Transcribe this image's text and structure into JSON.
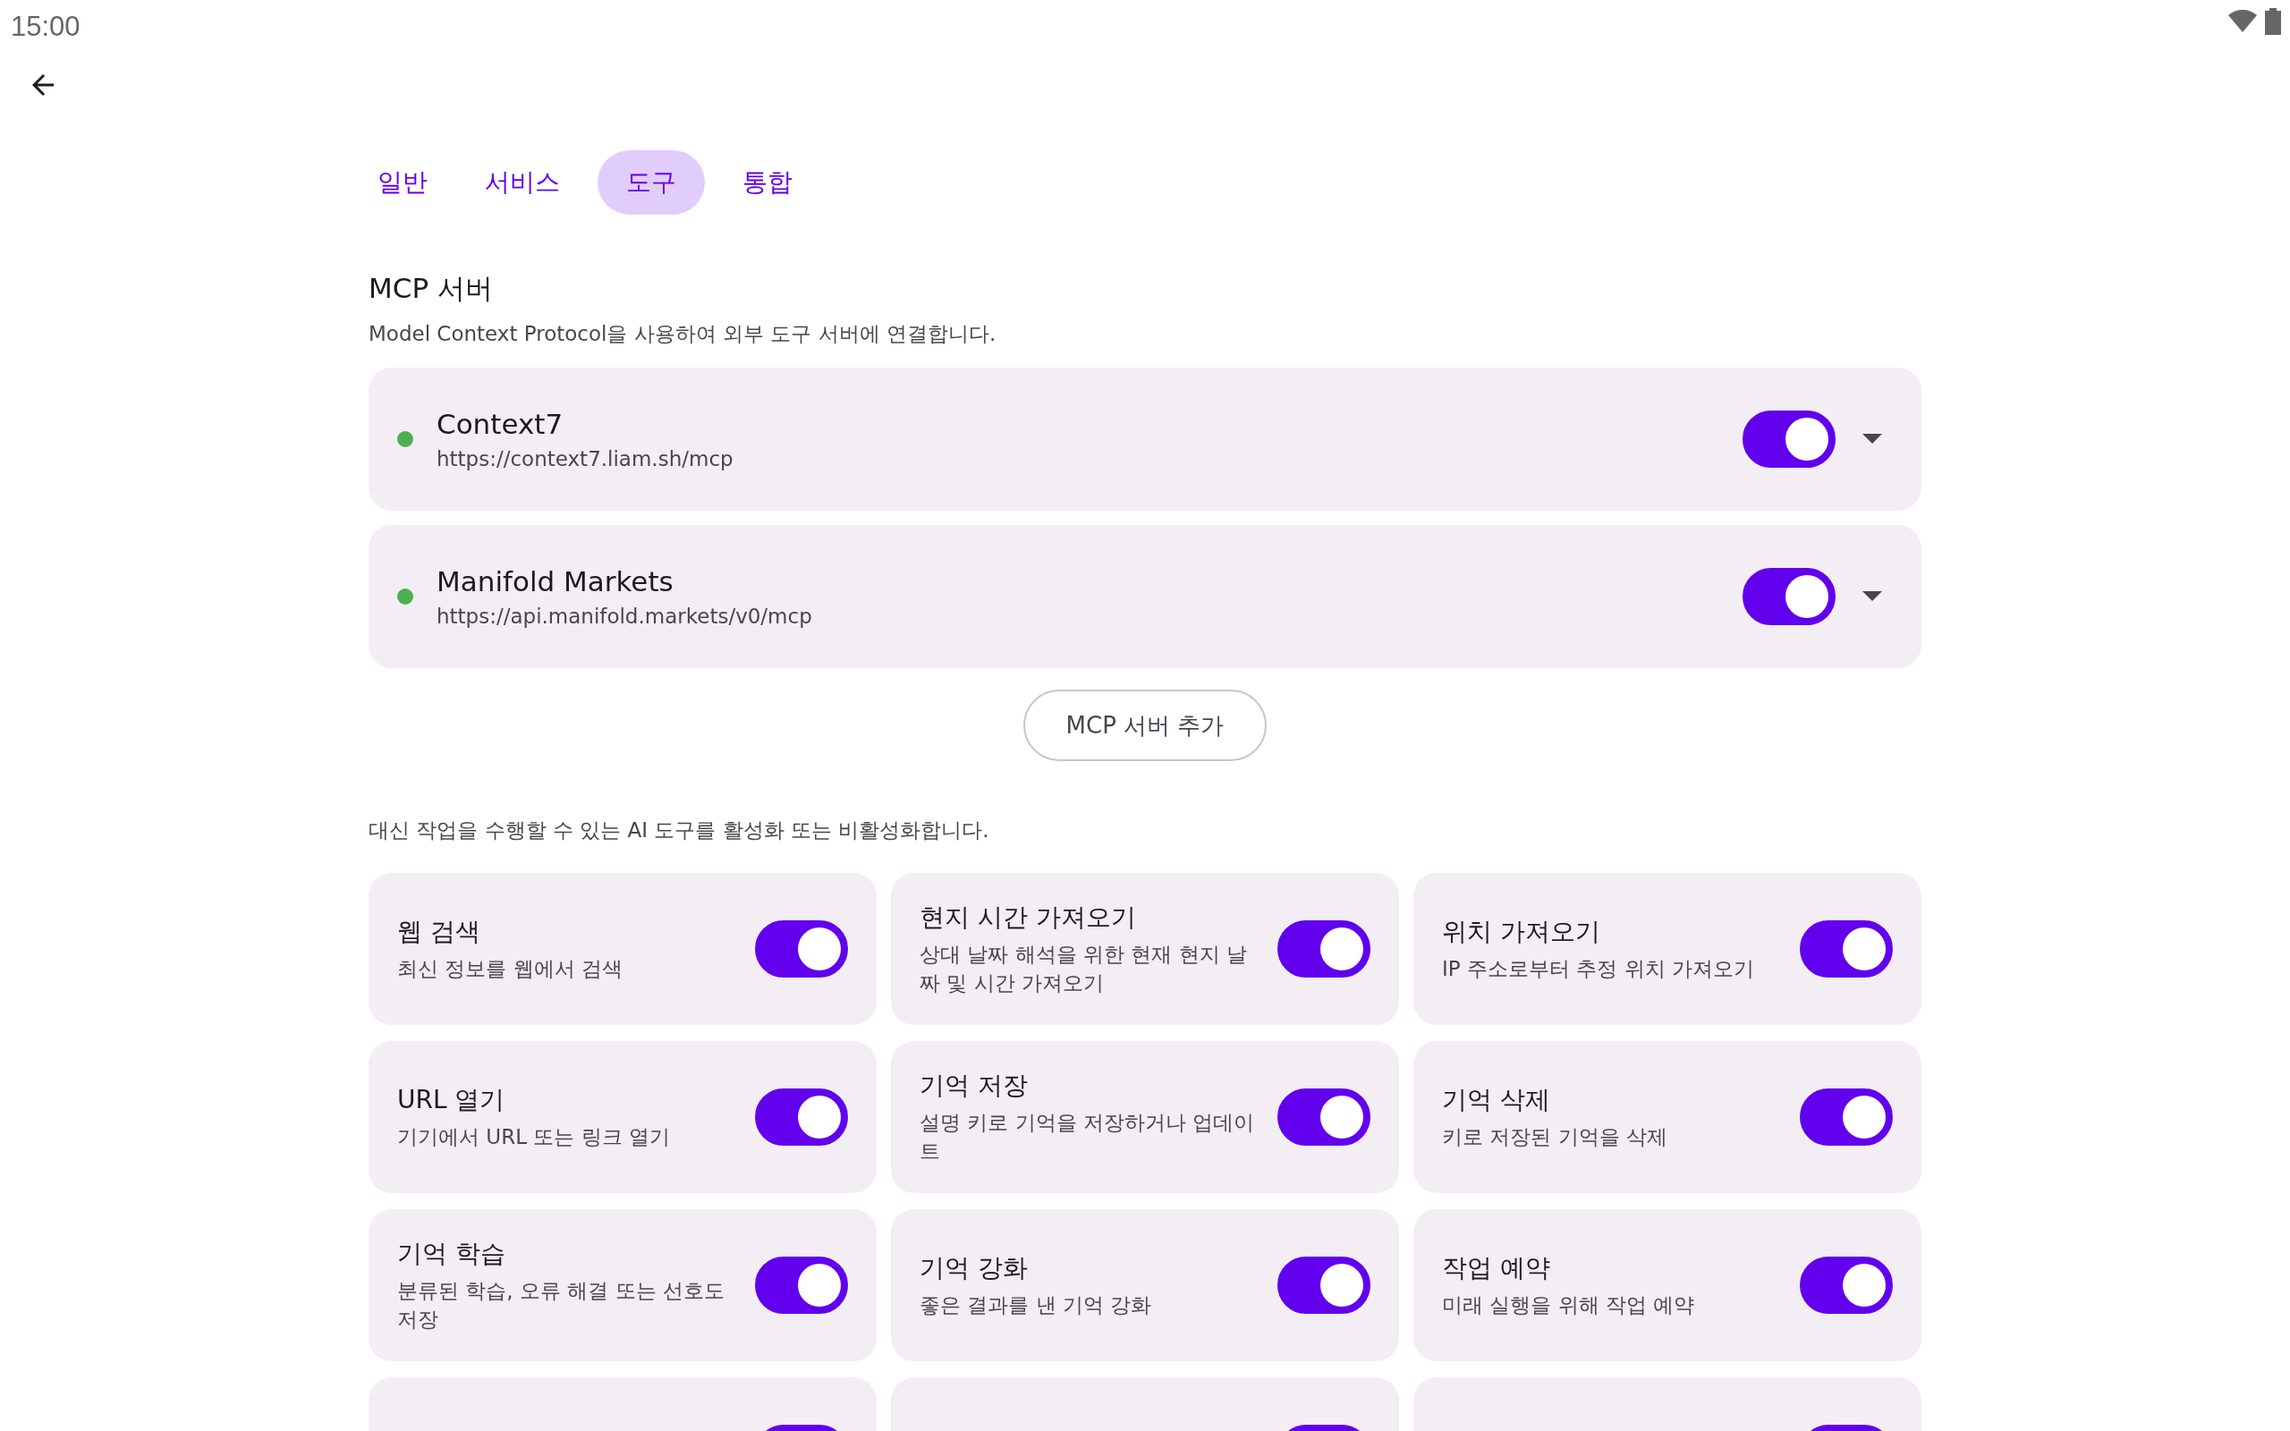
{
  "status_bar": {
    "time": "15:00"
  },
  "tabs": [
    {
      "label": "일반",
      "selected": false
    },
    {
      "label": "서비스",
      "selected": false
    },
    {
      "label": "도구",
      "selected": true
    },
    {
      "label": "통합",
      "selected": false
    }
  ],
  "mcp_section": {
    "title": "MCP 서버",
    "description": "Model Context Protocol을 사용하여 외부 도구 서버에 연결합니다.",
    "servers": [
      {
        "name": "Context7",
        "url": "https://context7.liam.sh/mcp",
        "color": "#4caf50",
        "on": true
      },
      {
        "name": "Manifold Markets",
        "url": "https://api.manifold.markets/v0/mcp",
        "color": "#4caf50",
        "on": true
      }
    ],
    "add_button": "MCP 서버 추가"
  },
  "tools_section": {
    "description": "대신 작업을 수행할 수 있는 AI 도구를 활성화 또는 비활성화합니다.",
    "tools": [
      {
        "name": "웹 검색",
        "description": "최신 정보를 웹에서 검색",
        "on": true
      },
      {
        "name": "현지 시간 가져오기",
        "description": "상대 날짜 해석을 위한 현재 현지 날짜 및 시간 가져오기",
        "on": true
      },
      {
        "name": "위치 가져오기",
        "description": "IP 주소로부터 추정 위치 가져오기",
        "on": true
      },
      {
        "name": "URL 열기",
        "description": "기기에서 URL 또는 링크 열기",
        "on": true
      },
      {
        "name": "기억 저장",
        "description": "설명 키로 기억을 저장하거나 업데이트",
        "on": true
      },
      {
        "name": "기억 삭제",
        "description": "키로 저장된 기억을 삭제",
        "on": true
      },
      {
        "name": "기억 학습",
        "description": "분류된 학습, 오류 해결 또는 선호도 저장",
        "on": true
      },
      {
        "name": "기억 강화",
        "description": "좋은 결과를 낸 기억 강화",
        "on": true
      },
      {
        "name": "작업 예약",
        "description": "미래 실행을 위해 작업 예약",
        "on": true
      },
      {
        "on": true
      },
      {
        "on": true
      },
      {
        "on": true
      }
    ]
  }
}
